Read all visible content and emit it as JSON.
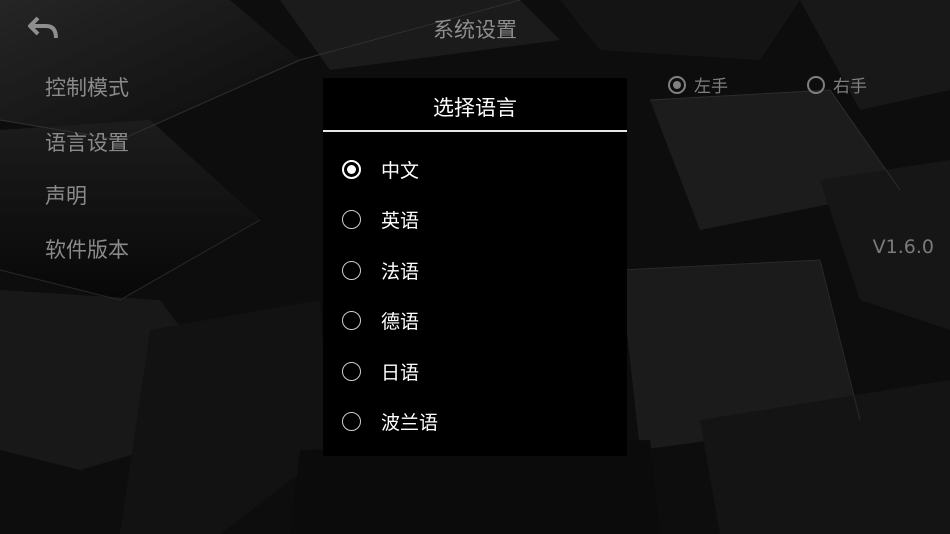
{
  "header": {
    "title": "系统设置",
    "back_icon": "back-arrow-icon"
  },
  "menu": [
    {
      "label": "控制模式"
    },
    {
      "label": "语言设置"
    },
    {
      "label": "声明"
    },
    {
      "label": "软件版本"
    }
  ],
  "control_mode": {
    "options": [
      {
        "label": "左手",
        "selected": true
      },
      {
        "label": "右手",
        "selected": false
      }
    ]
  },
  "software_version": {
    "value": "V1.6.0"
  },
  "language_dialog": {
    "title": "选择语言",
    "options": [
      {
        "label": "中文",
        "selected": true
      },
      {
        "label": "英语",
        "selected": false
      },
      {
        "label": "法语",
        "selected": false
      },
      {
        "label": "德语",
        "selected": false
      },
      {
        "label": "日语",
        "selected": false
      },
      {
        "label": "波兰语",
        "selected": false
      }
    ]
  },
  "colors": {
    "dialog_bg": "#000000",
    "dialog_text": "#ffffff",
    "dim_text": "#8a8a8a"
  }
}
